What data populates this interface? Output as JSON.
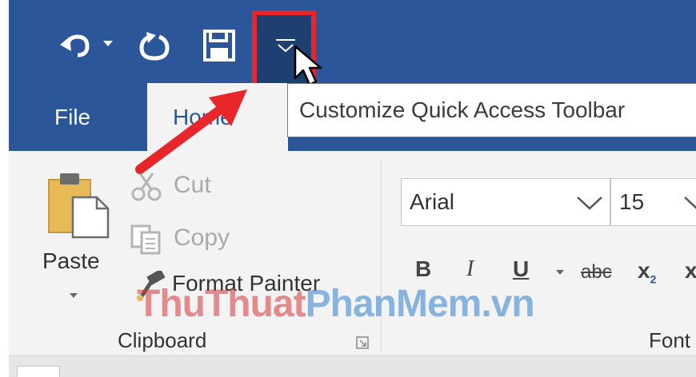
{
  "quick_access": {
    "undo_icon": "undo-icon",
    "undo_dropdown_icon": "chevron-down-icon",
    "redo_icon": "redo-icon",
    "save_icon": "save-icon",
    "customize_icon": "chevron-down-icon",
    "cursor_icon": "mouse-pointer-icon"
  },
  "tabs": [
    {
      "label": "File"
    },
    {
      "label": "Home"
    }
  ],
  "tooltip": {
    "text": "Customize Quick Access Toolbar"
  },
  "clipboard": {
    "paste_label": "Paste",
    "cut_label": "Cut",
    "copy_label": "Copy",
    "format_painter_label": "Format Painter",
    "group_label": "Clipboard"
  },
  "font": {
    "font_name": "Arial",
    "font_size": "15",
    "group_label": "Font",
    "bold_label": "B",
    "italic_label": "I",
    "underline_label": "U",
    "strikethrough_label": "abc",
    "subscript_label": "x",
    "subscript_mark": "2",
    "superscript_label": "x"
  },
  "watermark": {
    "part1": "ThuThuat",
    "part2": "PhanMem",
    "part3": ".vn"
  },
  "colors": {
    "ribbon_blue": "#2b579a",
    "highlight_red": "#e8262a",
    "arrow_red": "#e8262a"
  }
}
